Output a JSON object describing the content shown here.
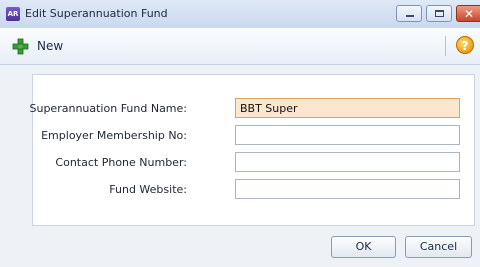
{
  "window": {
    "app_icon_text": "AR",
    "title": "Edit Superannuation Fund"
  },
  "toolbar": {
    "new_label": "New"
  },
  "form": {
    "fund_name": {
      "label": "Superannuation Fund Name:",
      "value": "BBT Super"
    },
    "membership_no": {
      "label": "Employer Membership No:",
      "value": ""
    },
    "phone": {
      "label": "Contact Phone Number:",
      "value": ""
    },
    "website": {
      "label": "Fund Website:",
      "value": ""
    }
  },
  "buttons": {
    "ok": "OK",
    "cancel": "Cancel"
  },
  "icons": {
    "new": "plus-icon",
    "help": "help-icon"
  },
  "colors": {
    "active_field": "#fbe6cf",
    "close_button": "#c8452b"
  }
}
